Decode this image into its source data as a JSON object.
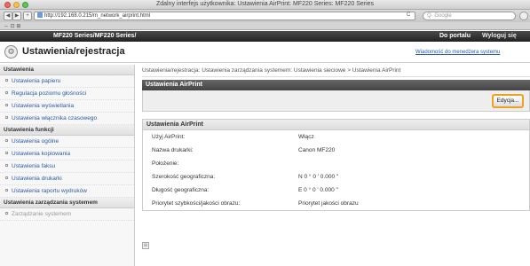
{
  "window": {
    "title": "Zdalny interfejs użytkownika: Ustawienia AirPrint: MF220 Series: MF220 Series"
  },
  "browser": {
    "url": "http://192.168.0.215/m_network_airprint.html",
    "search_placeholder": "Q· Google",
    "reload_glyph": "C",
    "back_glyph": "◀",
    "forward_glyph": "▶",
    "add_glyph": "+",
    "bookmarks_glyph": "⇔ ⊡ ⊞"
  },
  "topbar": {
    "crumb": "MF220 Series/MF220 Series/",
    "portal_link": "Do portalu",
    "logout_link": "Wyloguj się"
  },
  "pagehead": {
    "logo_glyph": "⚙",
    "title": "Ustawienia/rejestracja",
    "mail_link": "Wiadomość do menedżera systemu"
  },
  "sidebar": {
    "sections": [
      {
        "label": "Ustawienia",
        "items": [
          "Ustawienia papieru",
          "Regulacja poziomu głośności",
          "Ustawienia wyświetlania",
          "Ustawienia włącznika czasowego"
        ]
      },
      {
        "label": "Ustawienia funkcji",
        "items": [
          "Ustawienia ogólne",
          "Ustawienia kopiowania",
          "Ustawienia faksu",
          "Ustawienia drukarki",
          "Ustawienia raportu wydruków"
        ]
      },
      {
        "label": "Ustawienia zarządzania systemem",
        "items": [
          "Zarządzanie systemem"
        ]
      }
    ]
  },
  "main": {
    "breadcrumb": "Ustawienia/rejestracja: Ustawienia zarządzania systemem: Ustawienia sieciowe > Ustawienia AirPrint",
    "panel_title": "Ustawienia AirPrint",
    "edit_button": "Edycja...",
    "section_title": "Ustawienia AirPrint",
    "rows": [
      {
        "label": "Użyj AirPrint:",
        "value": "Włącz"
      },
      {
        "label": "Nazwa drukarki:",
        "value": "Canon MF220"
      },
      {
        "label": "Położenie:",
        "value": ""
      },
      {
        "label": "Szerokość geograficzna:",
        "value": "N 0 ° 0 ' 0.000 \""
      },
      {
        "label": "Długość geograficzna:",
        "value": "E 0 ° 0 ' 0.000 \""
      },
      {
        "label": "Priorytet szybkości/jakości obrazu:",
        "value": "Priorytet jakości obrazu"
      }
    ],
    "scroll_glyph": "⊞"
  }
}
